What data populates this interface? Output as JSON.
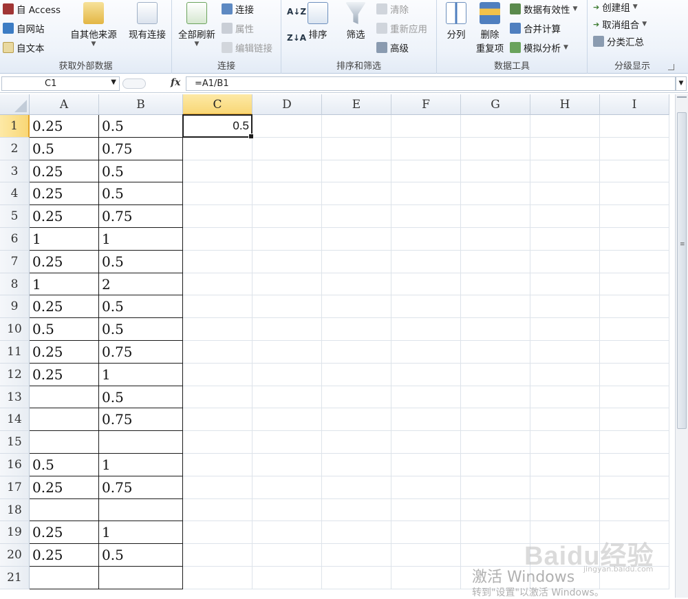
{
  "ribbon": {
    "get_external": {
      "label": "获取外部数据",
      "from_access": "自 Access",
      "from_web": "自网站",
      "from_text": "自文本",
      "from_other": "自其他来源",
      "existing": "现有连接"
    },
    "connections": {
      "label": "连接",
      "refresh_all": "全部刷新",
      "connections": "连接",
      "properties": "属性",
      "edit_links": "编辑链接"
    },
    "sort_filter": {
      "label": "排序和筛选",
      "sort": "排序",
      "filter": "筛选",
      "clear": "清除",
      "reapply": "重新应用",
      "advanced": "高级"
    },
    "data_tools": {
      "label": "数据工具",
      "text_to_columns": "分列",
      "remove_dup_1": "删除",
      "remove_dup_2": "重复项",
      "validation": "数据有效性",
      "consolidate": "合并计算",
      "what_if": "模拟分析"
    },
    "outline": {
      "label": "分级显示",
      "group": "创建组",
      "ungroup": "取消组合",
      "subtotal": "分类汇总"
    }
  },
  "formula_bar": {
    "name_box": "C1",
    "fx": "fx",
    "formula": "=A1/B1"
  },
  "columns": [
    "A",
    "B",
    "C",
    "D",
    "E",
    "F",
    "G",
    "H",
    "I"
  ],
  "rows": [
    {
      "n": "1",
      "a": "0.25",
      "b": "0.5",
      "c": "0.5"
    },
    {
      "n": "2",
      "a": "0.5",
      "b": "0.75",
      "c": ""
    },
    {
      "n": "3",
      "a": "0.25",
      "b": "0.5",
      "c": ""
    },
    {
      "n": "4",
      "a": "0.25",
      "b": "0.5",
      "c": ""
    },
    {
      "n": "5",
      "a": "0.25",
      "b": "0.75",
      "c": ""
    },
    {
      "n": "6",
      "a": "1",
      "b": "1",
      "c": ""
    },
    {
      "n": "7",
      "a": "0.25",
      "b": "0.5",
      "c": ""
    },
    {
      "n": "8",
      "a": "1",
      "b": "2",
      "c": ""
    },
    {
      "n": "9",
      "a": "0.25",
      "b": "0.5",
      "c": ""
    },
    {
      "n": "10",
      "a": "0.5",
      "b": "0.5",
      "c": ""
    },
    {
      "n": "11",
      "a": "0.25",
      "b": "0.75",
      "c": ""
    },
    {
      "n": "12",
      "a": "0.25",
      "b": "1",
      "c": ""
    },
    {
      "n": "13",
      "a": "",
      "b": "0.5",
      "c": ""
    },
    {
      "n": "14",
      "a": "",
      "b": "0.75",
      "c": ""
    },
    {
      "n": "15",
      "a": "",
      "b": "",
      "c": ""
    },
    {
      "n": "16",
      "a": "0.5",
      "b": "1",
      "c": ""
    },
    {
      "n": "17",
      "a": "0.25",
      "b": "0.75",
      "c": ""
    },
    {
      "n": "18",
      "a": "",
      "b": "",
      "c": ""
    },
    {
      "n": "19",
      "a": "0.25",
      "b": "1",
      "c": ""
    },
    {
      "n": "20",
      "a": "0.25",
      "b": "0.5",
      "c": ""
    },
    {
      "n": "21",
      "a": "",
      "b": "",
      "c": ""
    }
  ],
  "selection": {
    "cell": "C1",
    "column": "C",
    "row": "1"
  },
  "watermarks": {
    "baidu": "Baidu经验",
    "url": "jingyan.baidu.com",
    "activate_title": "激活 Windows",
    "activate_hint": "转到\"设置\"以激活 Windows。"
  },
  "colors": {
    "selection_header": "#f9d776",
    "selection_accent": "#e2a42b",
    "ribbon_bg": "#eef3fa",
    "grid_line": "#dde3ea",
    "cell_border": "#1a1a1a"
  }
}
